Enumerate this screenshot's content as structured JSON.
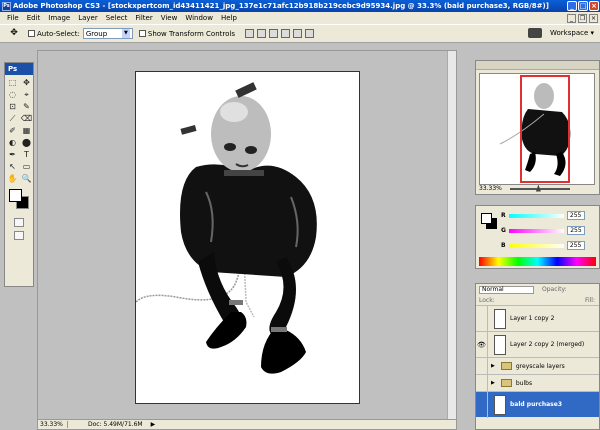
{
  "window": {
    "title": "Adobe Photoshop CS3 - [stockxpertcom_id43411421_jpg_137e1c71afc12b918b219cebc9d95934.jpg @ 33.3% (bald purchase3, RGB/8#)]",
    "app_icon_text": "Ps",
    "minimize": "_",
    "maximize": "□",
    "close": "×"
  },
  "menu": {
    "items": [
      "File",
      "Edit",
      "Image",
      "Layer",
      "Select",
      "Filter",
      "View",
      "Window",
      "Help"
    ],
    "doc_minimize": "_",
    "doc_restore": "❐",
    "doc_close": "×"
  },
  "options": {
    "auto_select_label": "Auto-Select:",
    "auto_select_value": "Group",
    "show_transform_label": "Show Transform Controls",
    "workspace_label": "Workspace ▾"
  },
  "toolbox": {
    "logo": "Ps",
    "tools": [
      "⬚",
      "✥",
      "◌",
      "⌖",
      "⊡",
      "✎",
      "⟋",
      "⌫",
      "✐",
      "▦",
      "◐",
      "⬤",
      "✒",
      "T",
      "↖",
      "▭",
      "✋",
      "🔍"
    ]
  },
  "status": {
    "zoom": "33.33%",
    "doc": "Doc: 5.49M/71.6M",
    "arrow": "▶"
  },
  "navigator": {
    "zoom": "33.33%"
  },
  "color": {
    "r_label": "R",
    "g_label": "G",
    "b_label": "B",
    "r_value": "255",
    "g_value": "255",
    "b_value": "255",
    "r_track": "#22c8d8",
    "g_track": "#e030e0",
    "b_track": "#e0e030"
  },
  "layers": {
    "blend_mode": "Normal",
    "opacity_label": "Opacity:",
    "lock_label": "Lock:",
    "fill_label": "Fill:",
    "rows": [
      {
        "name": "Layer 1 copy 2",
        "visible": "",
        "type": "layer"
      },
      {
        "name": "Layer 2 copy 2 (merged)",
        "visible": "👁",
        "type": "layer"
      },
      {
        "name": "greyscale layers",
        "visible": "",
        "type": "group"
      },
      {
        "name": "bulbs",
        "visible": "",
        "type": "group"
      },
      {
        "name": "bald purchase3",
        "visible": "",
        "type": "layer"
      }
    ]
  }
}
